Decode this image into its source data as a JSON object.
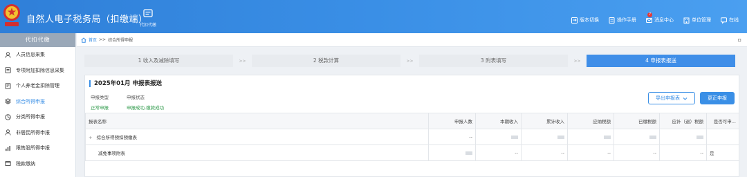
{
  "header": {
    "title": "自然人电子税务局（扣缴端）",
    "module_label": "代扣代缴",
    "tools": [
      {
        "label": "版本切换",
        "icon": "switch-icon"
      },
      {
        "label": "操作手册",
        "icon": "manual-icon"
      },
      {
        "label": "消息中心",
        "icon": "message-icon",
        "badge": "7"
      },
      {
        "label": "单位管理",
        "icon": "unit-icon"
      },
      {
        "label": "在线",
        "icon": "chat-icon"
      }
    ]
  },
  "sidebar": {
    "heading": "代扣代缴",
    "items": [
      {
        "label": "人员信息采集",
        "icon": "person-icon"
      },
      {
        "label": "专项附加扣除信息采集",
        "icon": "special-deduction-icon"
      },
      {
        "label": "个人养老金扣除管理",
        "icon": "pension-icon"
      },
      {
        "label": "综合所得申报",
        "icon": "comprehensive-icon"
      },
      {
        "label": "分类所得申报",
        "icon": "category-icon"
      },
      {
        "label": "非居民所得申报",
        "icon": "nonresident-icon"
      },
      {
        "label": "限售股所得申报",
        "icon": "stock-icon"
      },
      {
        "label": "税款缴纳",
        "icon": "payment-icon"
      }
    ]
  },
  "breadcrumb": {
    "home": "首页",
    "sep": ">>",
    "current": "综合所得申报"
  },
  "steps": [
    {
      "label": "1 收入及减除填写"
    },
    {
      "label": "2 税款计算"
    },
    {
      "label": "3 附表填写"
    },
    {
      "label": "4 申报表报送"
    }
  ],
  "step_sep": ">>",
  "panel": {
    "title": "2025年01月  申报表报送",
    "type_label": "申报类型",
    "type_value": "正常申报",
    "status_label": "申报状态",
    "status_value": "申报成功,缴款成功",
    "export_label": "导出申报表",
    "correct_label": "更正申报"
  },
  "table": {
    "headers": [
      "报表名称",
      "申报人数",
      "本期收入",
      "累计收入",
      "应纳税额",
      "已缴税额",
      "应补（退）税额",
      "是否可申..."
    ],
    "rows": [
      {
        "name": "综合所得预扣预缴表",
        "tree": "+",
        "count": "--",
        "income": "",
        "cum": "",
        "tax": "",
        "paid": "",
        "due": "",
        "ok": ""
      },
      {
        "name": "减免事项附表",
        "tree": "",
        "count": "",
        "income": "--",
        "cum": "--",
        "tax": "--",
        "paid": "--",
        "due": "--",
        "ok": "是"
      }
    ]
  }
}
